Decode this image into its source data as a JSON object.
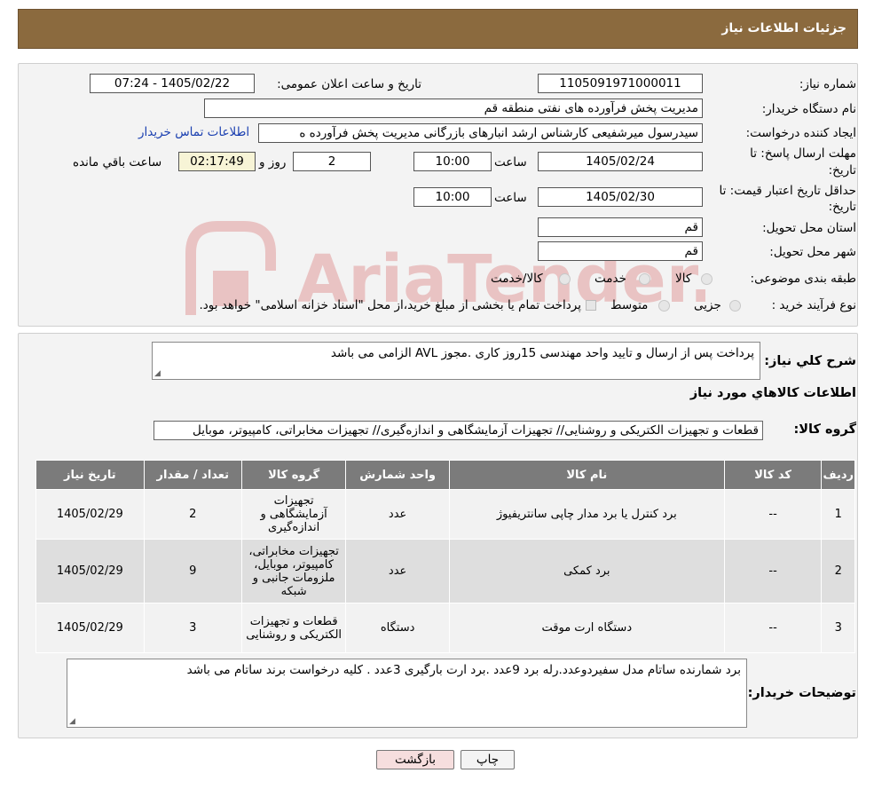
{
  "header": {
    "title": "جزئیات اطلاعات نیاز"
  },
  "form": {
    "need_number_label": "شماره نیاز:",
    "need_number": "1105091971000011",
    "announce_label": "تاریخ و ساعت اعلان عمومی:",
    "announce_value": "1405/02/22 - 07:24",
    "buyer_org_label": "نام دستگاه خریدار:",
    "buyer_org": "مدیریت پخش فرآورده های نفتی منطقه قم",
    "creator_label": "ایجاد کننده درخواست:",
    "creator": "سیدرسول میرشفیعی کارشناس ارشد انبارهای بازرگانی مدیریت پخش فرآورده ه",
    "contact_link": "اطلاعات تماس خریدار",
    "reply_deadline_label_1": "مهلت ارسال پاسخ: تا",
    "reply_deadline_label_2": "تاریخ:",
    "reply_date": "1405/02/24",
    "time_label": "ساعت",
    "reply_time": "10:00",
    "days_value": "2",
    "days_label": "روز و",
    "remaining_time": "02:17:49",
    "remaining_label": "ساعت باقي مانده",
    "validity_label_1": "حداقل تاریخ اعتبار قیمت: تا",
    "validity_label_2": "تاریخ:",
    "validity_date": "1405/02/30",
    "validity_time": "10:00",
    "province_label": "استان محل تحویل:",
    "province": "قم",
    "city_label": "شهر محل تحویل:",
    "city": "قم",
    "category_label": "طبقه بندی موضوعی:",
    "category_options": [
      "کالا",
      "خدمت",
      "کالا/خدمت"
    ],
    "process_label": "نوع فرآیند خرید :",
    "process_options": [
      "جزیی",
      "متوسط"
    ],
    "process_note": "پرداخت تمام یا بخشی از مبلغ خرید،از محل \"اسناد خزانه اسلامی\" خواهد بود."
  },
  "description": {
    "label": "شرح کلي نياز:",
    "text": "پرداخت پس از ارسال و تایید واحد مهندسی 15روز کاری .مجوز AVL الزامی می باشد"
  },
  "goods": {
    "section_title": "اطلاعات کالاهاي مورد نياز",
    "group_label": "گروه کالا:",
    "group_value": "قطعات و تجهیزات الکتریکی و روشنایی// تجهیزات آزمایشگاهی و اندازه‌گیری// تجهیزات مخابراتی، کامپیوتر، موبایل"
  },
  "table": {
    "headers": [
      "ردیف",
      "کد کالا",
      "نام کالا",
      "واحد شمارش",
      "گروه کالا",
      "تعداد / مقدار",
      "تاریخ نیاز"
    ],
    "rows": [
      {
        "row": "1",
        "code": "--",
        "name": "برد کنترل یا برد مدار چاپی سانتریفیوژ",
        "unit": "عدد",
        "group": "تجهیزات آزمایشگاهی و اندازه‌گیری",
        "qty": "2",
        "date": "1405/02/29"
      },
      {
        "row": "2",
        "code": "--",
        "name": "برد کمکی",
        "unit": "عدد",
        "group": "تجهیزات مخابراتی، کامپیوتر، موبایل، ملزومات جانبی و شبکه",
        "qty": "9",
        "date": "1405/02/29"
      },
      {
        "row": "3",
        "code": "--",
        "name": "دستگاه ارت موقت",
        "unit": "دستگاه",
        "group": "قطعات و تجهیزات الکتریکی و روشنایی",
        "qty": "3",
        "date": "1405/02/29"
      }
    ]
  },
  "buyer_notes": {
    "label": "توضیحات خریدار:",
    "text": "برد شمارنده ساتام مدل سفیردوعدد.رله برد 9عدد .برد ارت بارگیری 3عدد .  کلیه درخواست  برند ساتام می باشد"
  },
  "buttons": {
    "print": "چاپ",
    "back": "بازگشت"
  },
  "watermark": {
    "text": "AriaTender.neT"
  },
  "colors": {
    "header_bg": "#8b6a3e",
    "table_header_bg": "#7b7b7b",
    "back_button_bg": "#f6dede",
    "link": "#1a3fb0"
  }
}
